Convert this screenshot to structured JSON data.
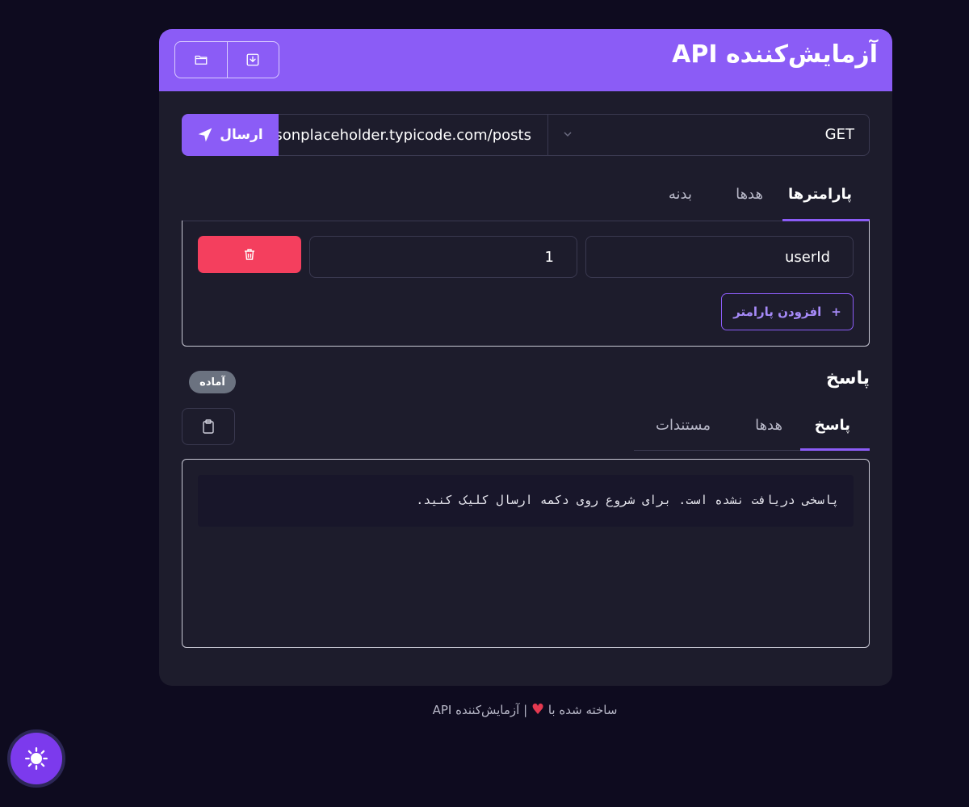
{
  "header": {
    "title": "آزمایش‌کننده API",
    "buttons": [
      {
        "name": "open-folder",
        "icon": "folder-icon"
      },
      {
        "name": "download",
        "icon": "download-icon"
      }
    ]
  },
  "request": {
    "method": "GET",
    "url": "https://jsonplaceholder.typicode.com/posts",
    "send_label": "ارسال"
  },
  "request_tabs": [
    {
      "label": "پارامترها",
      "active": true
    },
    {
      "label": "هدها",
      "active": false
    },
    {
      "label": "بدنه",
      "active": false
    }
  ],
  "params": {
    "rows": [
      {
        "key": "userId",
        "value": "1"
      }
    ],
    "add_label": "افزودن پارامتر"
  },
  "response": {
    "title": "پاسخ",
    "status": "آماده",
    "tabs": [
      {
        "label": "پاسخ",
        "active": true
      },
      {
        "label": "هدها",
        "active": false
      },
      {
        "label": "مستندات",
        "active": false
      }
    ],
    "body": "پاسخی دریافت نشده است. برای شروع روی دکمه ارسال کلیک کنید."
  },
  "footer": {
    "prefix": "ساخته شده با",
    "suffix": "| آزمایش‌کننده API"
  },
  "colors": {
    "accent": "#8b5cf6",
    "danger": "#f43f5e",
    "background": "#0e0b1f",
    "card": "#1d1c2c"
  }
}
